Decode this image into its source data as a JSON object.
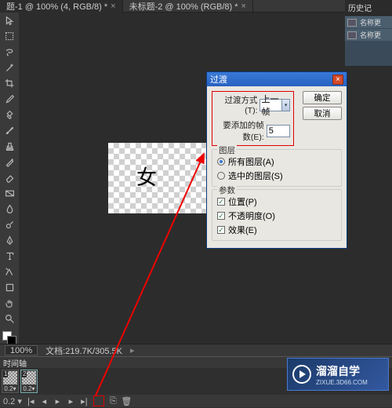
{
  "tabs": {
    "t1": "题-1 @ 100% (4, RGB/8) *",
    "t2": "未标题-2 @ 100% (RGB/8) *"
  },
  "rpanel": {
    "hdr": "历史记",
    "r1": "名称更",
    "r2": "名称更",
    "r3": ""
  },
  "canvas": {
    "txt": "女"
  },
  "dlg": {
    "title": "过渡",
    "lbl_method": "过渡方式(T):",
    "sel_method": "上一帧",
    "lbl_frames": "要添加的帧数(E):",
    "inp_frames": "5",
    "btn_ok": "确定",
    "btn_cancel": "取消",
    "fs_layers": "图层",
    "opt_all": "所有图层(A)",
    "opt_sel": "选中的图层(S)",
    "fs_params": "参数",
    "chk_pos": "位置(P)",
    "chk_opa": "不透明度(O)",
    "chk_eff": "效果(E)"
  },
  "status": {
    "zoom": "100%",
    "doc": "文档:219.7K/305.5K"
  },
  "tl": {
    "hdr": "时间轴",
    "f1": "1",
    "f2": "2",
    "d": "0.2▾",
    "loop": "0.2 ▾"
  },
  "wm": {
    "t": "溜溜自学",
    "s": "ZIXUE.3D66.COM"
  }
}
